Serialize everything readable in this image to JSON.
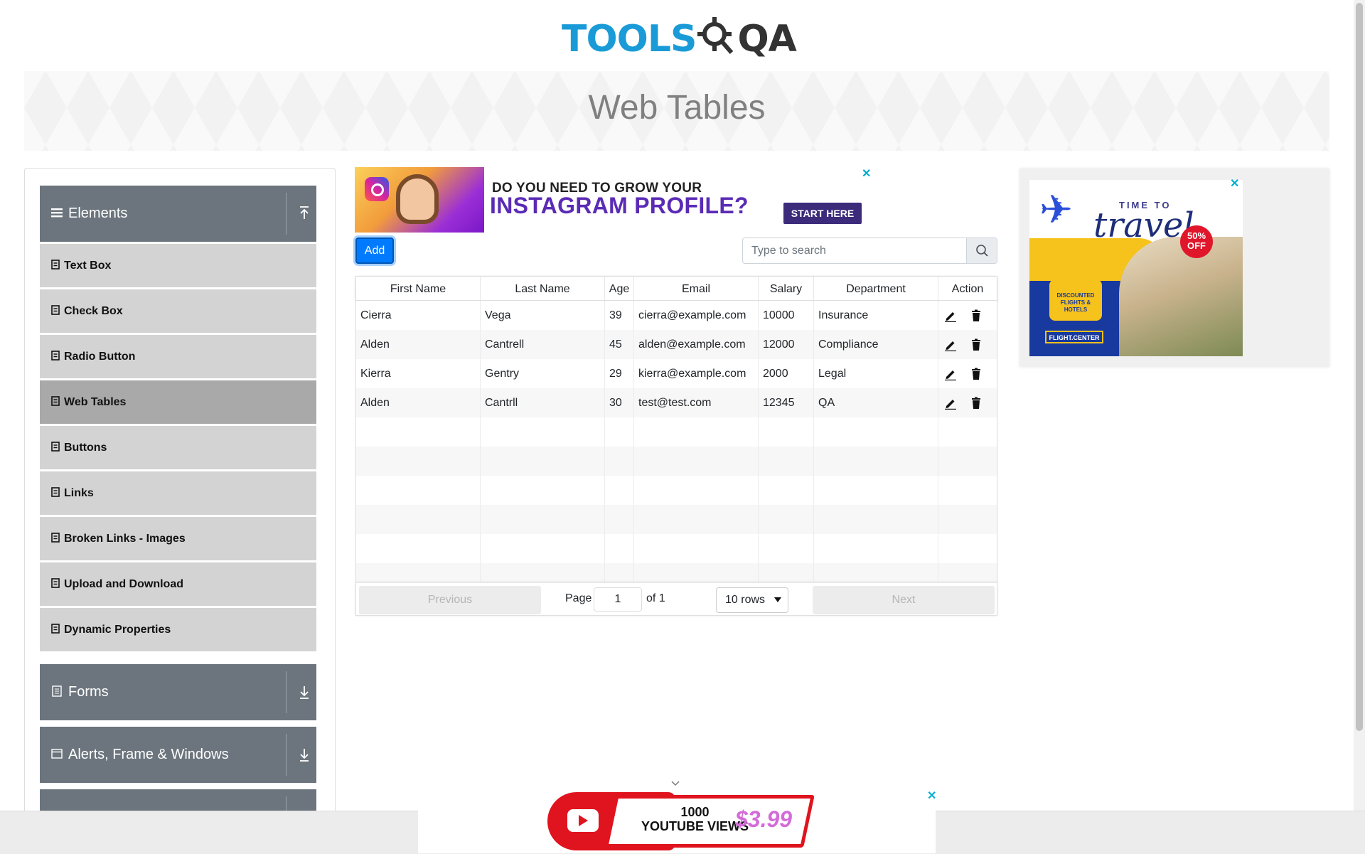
{
  "logo": {
    "part1": "TOOLS",
    "part2": "QA"
  },
  "banner": {
    "title": "Web Tables"
  },
  "sidebar": {
    "groups": [
      {
        "label": "Elements",
        "icon": "hamburger-icon",
        "arrow": "collapse-up-icon"
      },
      {
        "label": "Forms",
        "icon": "form-icon",
        "arrow": "expand-down-icon"
      },
      {
        "label": "Alerts, Frame & Windows",
        "icon": "window-icon",
        "arrow": "expand-down-icon"
      }
    ],
    "items": [
      {
        "label": "Text Box"
      },
      {
        "label": "Check Box"
      },
      {
        "label": "Radio Button"
      },
      {
        "label": "Web Tables"
      },
      {
        "label": "Buttons"
      },
      {
        "label": "Links"
      },
      {
        "label": "Broken Links - Images"
      },
      {
        "label": "Upload and Download"
      },
      {
        "label": "Dynamic Properties"
      }
    ],
    "active_item": "Web Tables"
  },
  "ad_top": {
    "line1": "DO YOU NEED TO GROW YOUR",
    "line2": "INSTAGRAM PROFILE?",
    "button": "START HERE",
    "close": "✕"
  },
  "toolbar": {
    "add_label": "Add",
    "search_placeholder": "Type to search"
  },
  "table": {
    "headers": [
      "First Name",
      "Last Name",
      "Age",
      "Email",
      "Salary",
      "Department",
      "Action"
    ],
    "rows": [
      [
        "Cierra",
        "Vega",
        "39",
        "cierra@example.com",
        "10000",
        "Insurance"
      ],
      [
        "Alden",
        "Cantrell",
        "45",
        "alden@example.com",
        "12000",
        "Compliance"
      ],
      [
        "Kierra",
        "Gentry",
        "29",
        "kierra@example.com",
        "2000",
        "Legal"
      ],
      [
        "Alden",
        "Cantrll",
        "30",
        "test@test.com",
        "12345",
        "QA"
      ]
    ],
    "empty_rows": 6
  },
  "pagination": {
    "previous": "Previous",
    "page_label": "Page",
    "page_value": "1",
    "of_label": "of 1",
    "rows_select": "10 rows",
    "next": "Next"
  },
  "ad_right": {
    "t1": "TIME TO",
    "t2": "travel",
    "badge": "50% OFF",
    "bubble": "DISCOUNTED FLIGHTS & HOTELS",
    "brand": "FLIGHT.CENTER",
    "close": "✕"
  },
  "ad_bottom": {
    "line1": "1000",
    "line2": "YOUTUBE VIEWS",
    "price": "$3.99",
    "close": "✕"
  },
  "colors": {
    "primary": "#007bff",
    "sidebar_group": "#6c757d",
    "sidebar_item": "#d3d3d3",
    "sidebar_active": "#a9a9a9",
    "logo_blue": "#1a9bd7"
  }
}
